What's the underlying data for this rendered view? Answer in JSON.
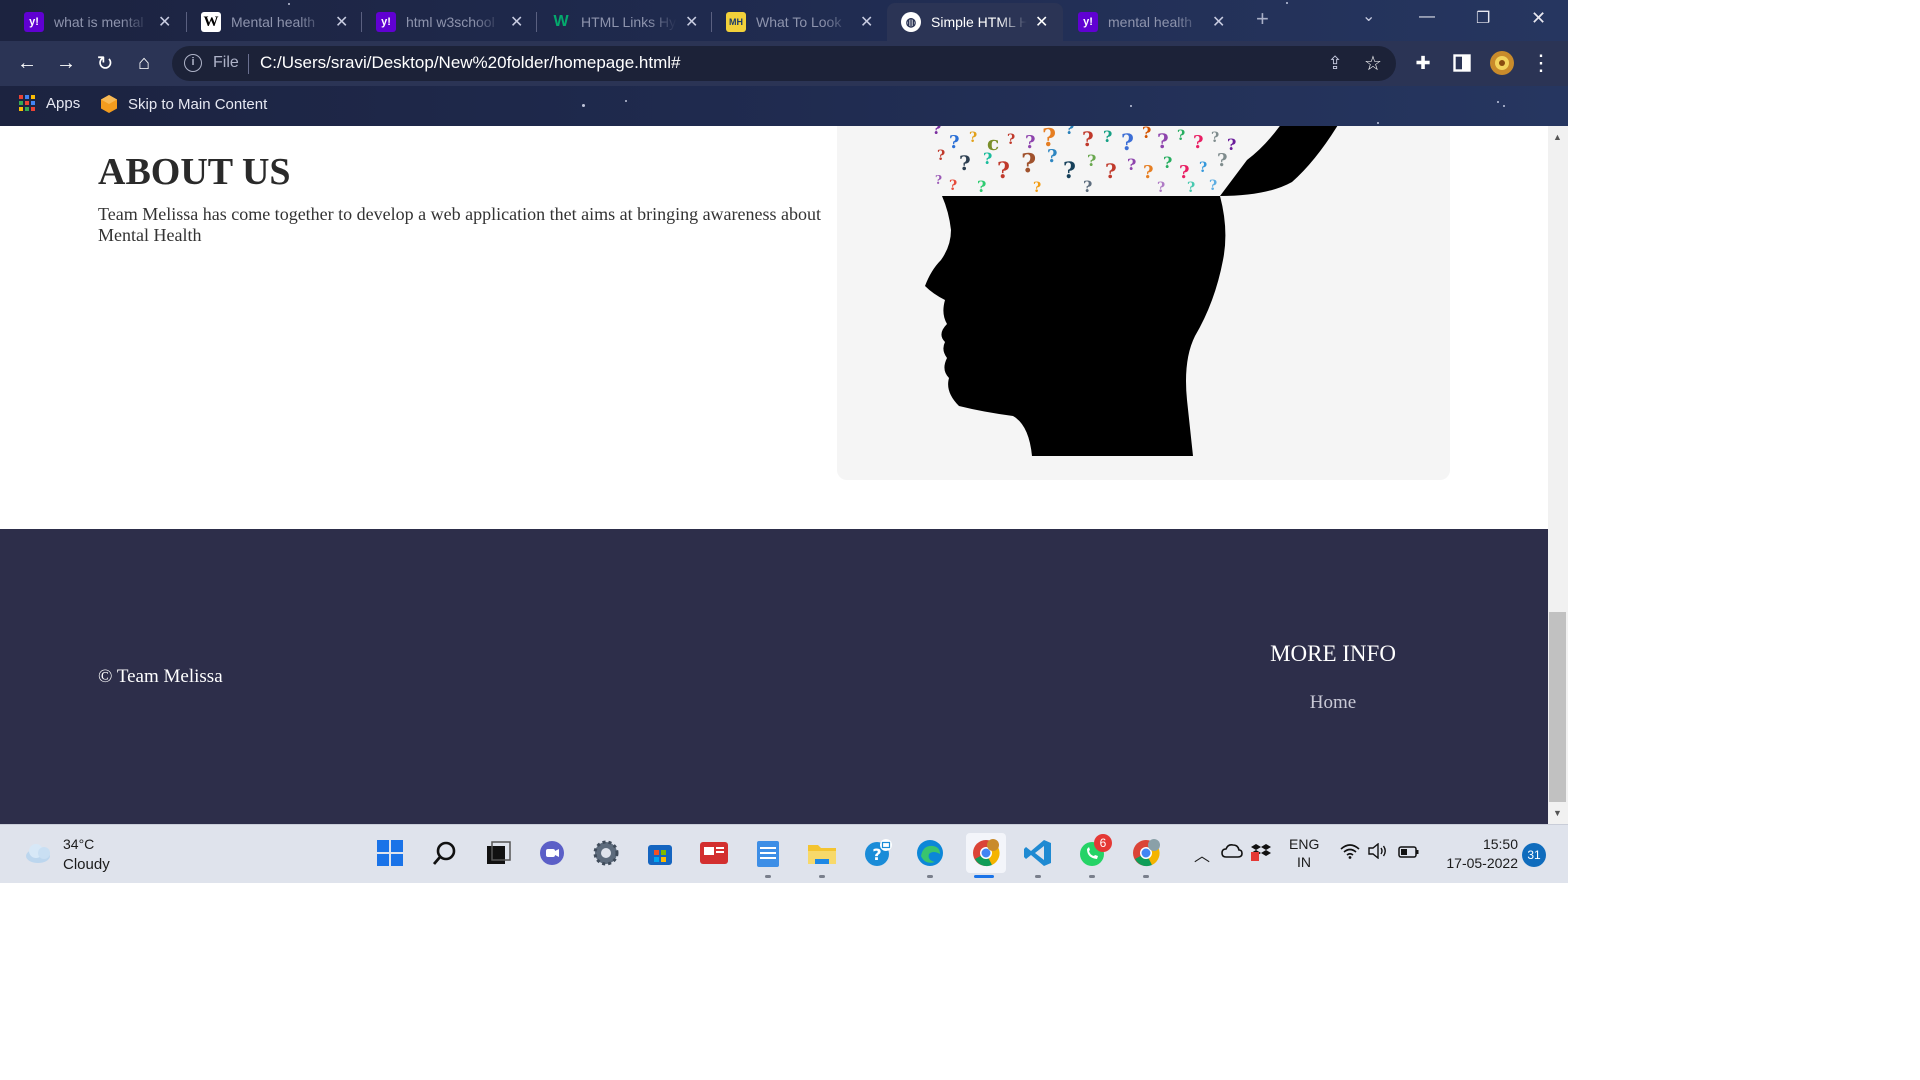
{
  "browser": {
    "tabs": [
      {
        "title": "what is mental",
        "icon": "yahoo-icon",
        "active": false
      },
      {
        "title": "Mental health",
        "icon": "wikipedia-icon",
        "active": false
      },
      {
        "title": "html w3school",
        "icon": "yahoo-icon",
        "active": false
      },
      {
        "title": "HTML Links Hy",
        "icon": "w3schools-icon",
        "active": false
      },
      {
        "title": "What To Look",
        "icon": "mhgov-icon",
        "active": false
      },
      {
        "title": "Simple HTML H",
        "icon": "globe-icon",
        "active": true
      },
      {
        "title": "mental health",
        "icon": "yahoo-icon",
        "active": false
      }
    ],
    "address": {
      "scheme_label": "File",
      "url": "C:/Users/sravi/Desktop/New%20folder/homepage.html#"
    },
    "bookmarks": [
      {
        "label": "Apps",
        "icon": "apps-grid-icon"
      },
      {
        "label": "Skip to Main Content",
        "icon": "bookmark-cube-icon"
      }
    ]
  },
  "page": {
    "about": {
      "title": "ABOUT US",
      "text": "Team Melissa has come together to develop a web application thet aims at bringing awareness about Mental Health"
    },
    "image": {
      "subject": "head-silhouette-question-marks"
    },
    "footer": {
      "copyright": "© Team Melissa",
      "more_info_title": "MORE INFO",
      "home_link": "Home"
    }
  },
  "taskbar": {
    "weather": {
      "temp": "34°C",
      "desc": "Cloudy"
    },
    "apps": [
      "windows-start-icon",
      "search-icon",
      "task-view-icon",
      "chat-icon",
      "settings-icon",
      "store-icon",
      "news-icon",
      "notepad-icon",
      "file-explorer-icon",
      "helper-icon",
      "edge-icon",
      "chrome-icon",
      "vscode-icon",
      "whatsapp-icon",
      "chrome-alt-icon"
    ],
    "whatsapp_badge": "6",
    "language": {
      "line1": "ENG",
      "line2": "IN"
    },
    "clock": {
      "time": "15:50",
      "date": "17-05-2022"
    },
    "notification_count": "31"
  },
  "colors": {
    "footer_bg": "#2d2e4a",
    "chrome_bg": "#2b3455",
    "image_card_bg": "#f5f5f5"
  }
}
